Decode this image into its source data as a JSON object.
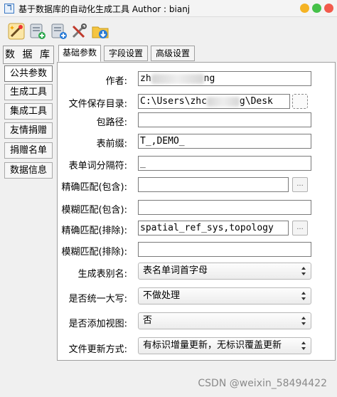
{
  "window": {
    "title": "基于数据库的自动化生成工具  Author : bianj",
    "app_icon_glyph": "ℸ"
  },
  "toolbar": {
    "icons": [
      "magic-wand-icon",
      "add-database-icon",
      "add-table-icon",
      "tools-icon",
      "download-folder-icon"
    ]
  },
  "sidebar": {
    "header": "数 据 库",
    "items": [
      {
        "label": "公共参数",
        "active": true
      },
      {
        "label": "生成工具"
      },
      {
        "label": "集成工具"
      },
      {
        "label": "友情捐赠"
      },
      {
        "label": "捐赠名单"
      },
      {
        "label": "数据信息"
      }
    ]
  },
  "tabs": [
    {
      "label": "基础参数",
      "active": true
    },
    {
      "label": "字段设置"
    },
    {
      "label": "高级设置"
    }
  ],
  "form": {
    "author": {
      "label": "作者:",
      "value_start": "zh",
      "value_end": "ng"
    },
    "save_dir": {
      "label": "文件保存目录:",
      "value_start": "C:\\Users\\zhc",
      "value_end": "g\\Desk"
    },
    "package_path": {
      "label": "包路径:",
      "value": ""
    },
    "table_prefix": {
      "label": "表前缀:",
      "value": "T_,DEMO_"
    },
    "word_separator": {
      "label": "表单词分隔符:",
      "value": "_"
    },
    "exact_include": {
      "label": "精确匹配(包含):",
      "value": ""
    },
    "fuzzy_include": {
      "label": "模糊匹配(包含):",
      "value": ""
    },
    "exact_exclude": {
      "label": "精确匹配(排除):",
      "value": "spatial_ref_sys,topology"
    },
    "fuzzy_exclude": {
      "label": "模糊匹配(排除):",
      "value": ""
    },
    "alias": {
      "label": "生成表别名:",
      "value": "表名单词首字母"
    },
    "uppercase": {
      "label": "是否统一大写:",
      "value": "不做处理"
    },
    "add_view": {
      "label": "是否添加视图:",
      "value": "否"
    },
    "update_mode": {
      "label": "文件更新方式:",
      "value": "有标识增量更新，无标识覆盖更新"
    },
    "dots_label": "..."
  },
  "watermark": "CSDN @weixin_58494422",
  "colors": {
    "close": "#f25a4c",
    "minimize": "#f5b323",
    "maximize": "#45c149"
  }
}
